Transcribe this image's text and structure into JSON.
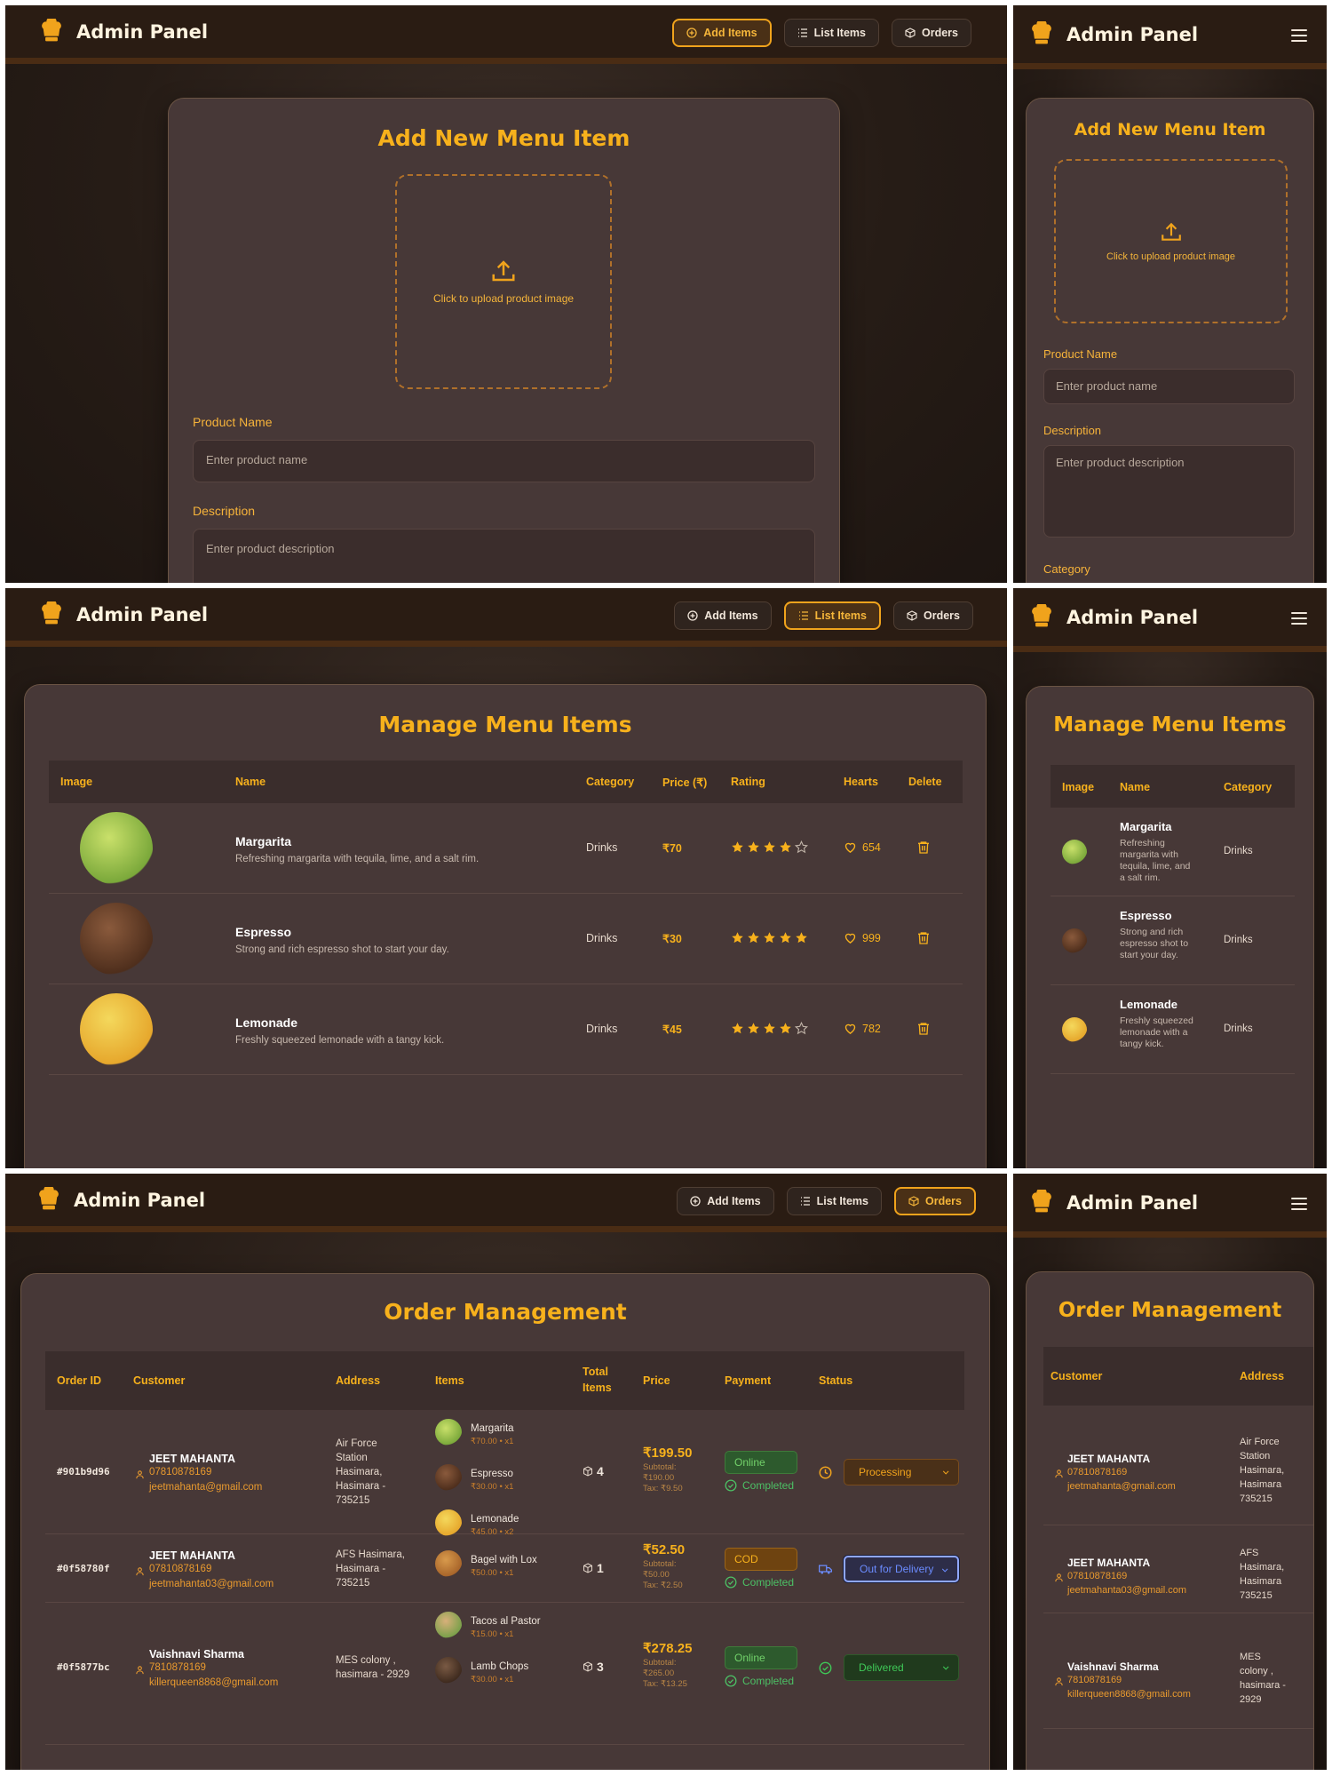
{
  "app": {
    "title": "Admin Panel"
  },
  "nav": {
    "add": "Add Items",
    "list": "List Items",
    "orders": "Orders"
  },
  "add_form": {
    "heading": "Add New Menu Item",
    "upload_text": "Click to upload product image",
    "name_label": "Product Name",
    "name_placeholder": "Enter product name",
    "desc_label": "Description",
    "desc_placeholder": "Enter product description",
    "category_label": "Category"
  },
  "list": {
    "heading": "Manage Menu Items",
    "columns": {
      "image": "Image",
      "name": "Name",
      "category": "Category",
      "price": "Price (₹)",
      "rating": "Rating",
      "hearts": "Hearts",
      "delete": "Delete"
    },
    "items": [
      {
        "name": "Margarita",
        "desc": "Refreshing margarita with tequila, lime, and a salt rim.",
        "desc_lines": [
          "Refreshing",
          "margarita with",
          "tequila, lime, and",
          "a salt rim."
        ],
        "category": "Drinks",
        "price": "₹70",
        "rating": 4,
        "hearts": "654"
      },
      {
        "name": "Espresso",
        "desc": "Strong and rich espresso shot to start your day.",
        "desc_lines": [
          "Strong and rich",
          "espresso shot to",
          "start your day."
        ],
        "category": "Drinks",
        "price": "₹30",
        "rating": 5,
        "hearts": "999"
      },
      {
        "name": "Lemonade",
        "desc": "Freshly squeezed lemonade with a tangy kick.",
        "desc_lines": [
          "Freshly squeezed",
          "lemonade with a",
          "tangy kick."
        ],
        "category": "Drinks",
        "price": "₹45",
        "rating": 4,
        "hearts": "782"
      }
    ]
  },
  "orders": {
    "heading": "Order Management",
    "columns": {
      "id": "Order ID",
      "customer": "Customer",
      "address": "Address",
      "items": "Items",
      "total_1": "Total",
      "total_2": "Items",
      "price": "Price",
      "payment": "Payment",
      "status": "Status"
    },
    "rows": [
      {
        "id": "#901b9d96",
        "name": "JEET MAHANTA",
        "phone": "07810878169",
        "email": "jeetmahanta@gmail.com",
        "address": [
          "Air Force",
          "Station",
          "Hasimara,",
          "Hasimara -",
          "735215"
        ],
        "items": [
          {
            "name": "Margarita",
            "meta": "₹70.00  •  x1"
          },
          {
            "name": "Espresso",
            "meta": "₹30.00  •  x1"
          },
          {
            "name": "Lemonade",
            "meta": "₹45.00  •  x2"
          }
        ],
        "total": "4",
        "price": "₹199.50",
        "subtotal": "Subtotal:",
        "subtotal_value": "₹190.00",
        "tax": "Tax: ₹9.50",
        "payment": "Online",
        "paid": "Completed",
        "status": "Processing"
      },
      {
        "id": "#0f58780f",
        "name": "JEET MAHANTA",
        "phone": "07810878169",
        "email": "jeetmahanta03@gmail.com",
        "address": [
          "AFS Hasimara,",
          "Hasimara -",
          "735215"
        ],
        "items": [
          {
            "name": "Bagel with Lox",
            "meta": "₹50.00  •  x1"
          }
        ],
        "total": "1",
        "price": "₹52.50",
        "subtotal": "Subtotal:",
        "subtotal_value": "₹50.00",
        "tax": "Tax: ₹2.50",
        "payment": "COD",
        "paid": "Completed",
        "status": "Out for Delivery"
      },
      {
        "id": "#0f5877bc",
        "name": "Vaishnavi Sharma",
        "phone": "7810878169",
        "email": "killerqueen8868@gmail.com",
        "address": [
          "MES colony ,",
          "hasimara - 2929"
        ],
        "items": [
          {
            "name": "Tacos al Pastor",
            "meta": "₹15.00  •  x1"
          },
          {
            "name": "Lamb Chops",
            "meta": "₹30.00  •  x1"
          }
        ],
        "total": "3",
        "price": "₹278.25",
        "subtotal": "Subtotal:",
        "subtotal_value": "₹265.00",
        "tax": "Tax: ₹13.25",
        "payment": "Online",
        "paid": "Completed",
        "status": "Delivered"
      }
    ],
    "mobile_address": [
      [
        "Air Force",
        "Station",
        "Hasimara,",
        "Hasimara",
        "735215"
      ],
      [
        "AFS",
        "Hasimara,",
        "Hasimara",
        "735215"
      ],
      [
        "MES",
        "colony ,",
        "hasimara -",
        "2929"
      ]
    ]
  },
  "colors": {
    "accent": "#f7b11c",
    "header_bg": "#2a1c13",
    "card_bg": "#473837",
    "online": "#72d16a",
    "cod": "#f7b11c",
    "delivered": "#3fc957",
    "ofd": "#6b8cff"
  }
}
